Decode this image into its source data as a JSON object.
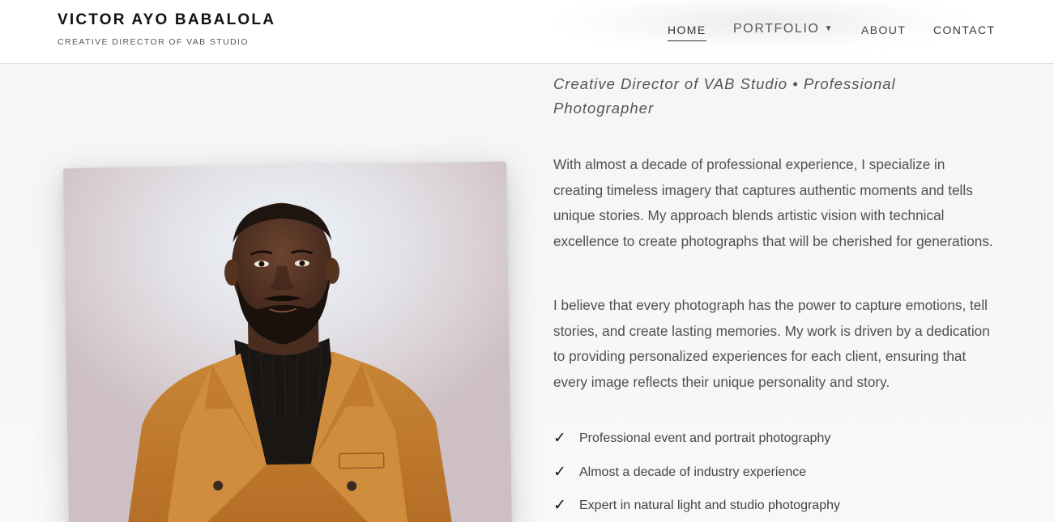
{
  "header": {
    "brand_name": "VICTOR AYO BABALOLA",
    "brand_tagline": "CREATIVE DIRECTOR OF VAB STUDIO",
    "nav": {
      "home": "HOME",
      "portfolio": "PORTFOLIO",
      "about": "ABOUT",
      "contact": "CONTACT",
      "active": "HOME"
    }
  },
  "about": {
    "subtitle": "Creative Director of VAB Studio • Professional Photographer",
    "paragraphs": [
      "With almost a decade of professional experience, I specialize in creating timeless imagery that captures authentic moments and tells unique stories. My approach blends artistic vision with technical excellence to create photographs that will be cherished for generations.",
      "I believe that every photograph has the power to capture emotions, tell stories, and create lasting memories. My work is driven by a dedication to providing personalized experiences for each client, ensuring that every image reflects their unique personality and story."
    ],
    "features": [
      {
        "check": "✓",
        "text": "Professional event and portrait photography"
      },
      {
        "check": "✓",
        "text": "Almost a decade of industry experience"
      },
      {
        "check": "✓",
        "text": "Expert in natural light and studio photography"
      }
    ]
  },
  "colors": {
    "background": "#f6f6f6",
    "header_bg": "#ffffff",
    "text": "#505050",
    "brand": "#111111",
    "coat": "#c57f32"
  },
  "icons": {
    "portfolio_caret": "caret-down-icon",
    "feature_check": "check-icon"
  }
}
